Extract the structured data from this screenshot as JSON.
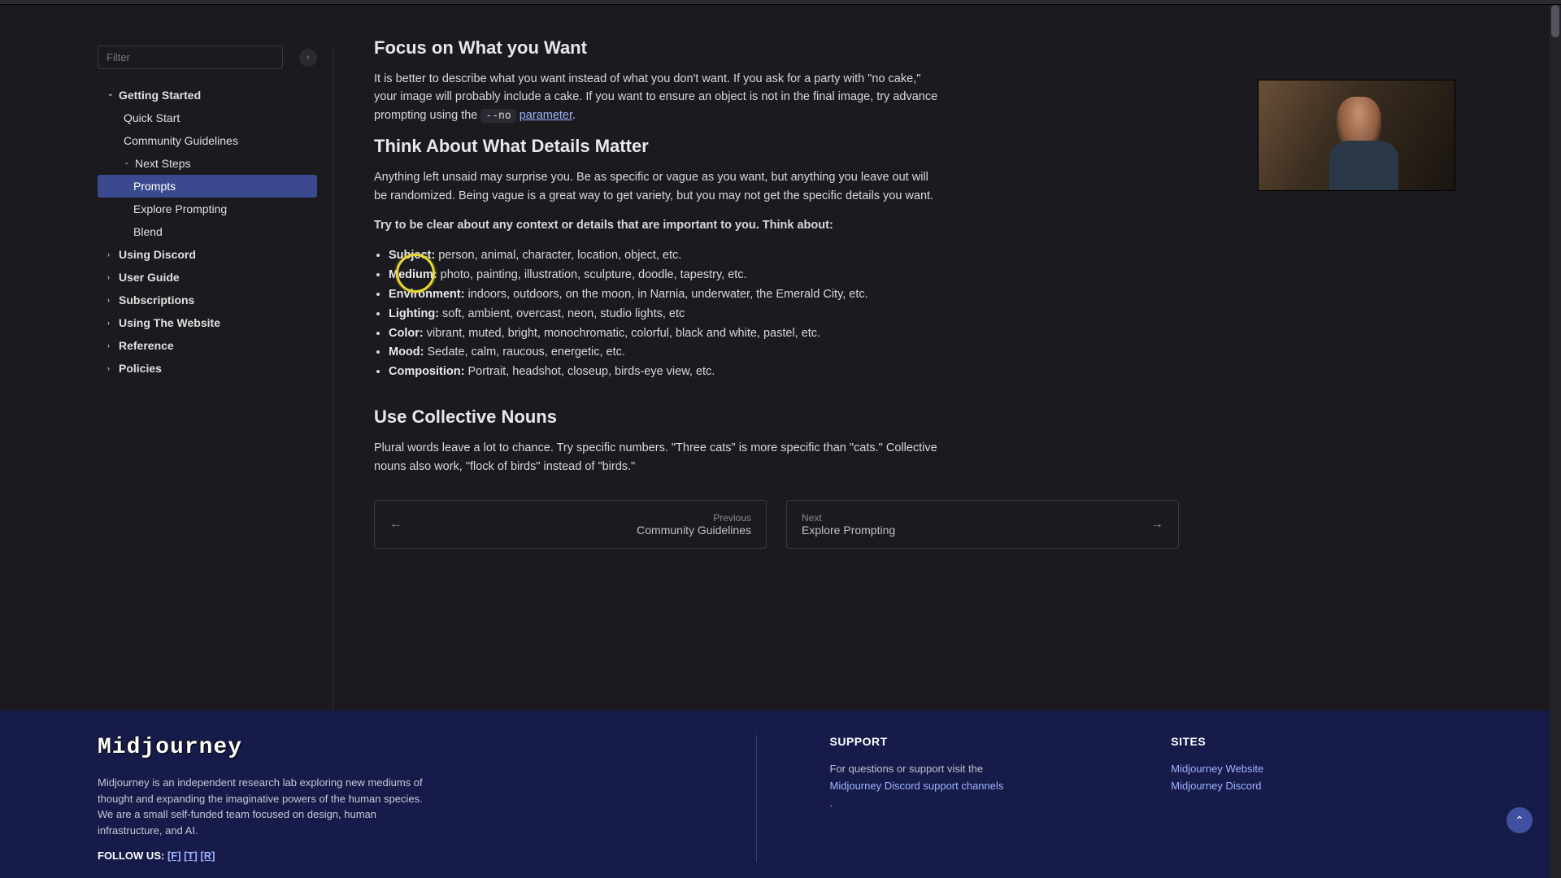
{
  "sidebar": {
    "filter_placeholder": "Filter",
    "items": [
      {
        "label": "Getting Started",
        "level": 1,
        "expanded": true
      },
      {
        "label": "Quick Start",
        "level": 2
      },
      {
        "label": "Community Guidelines",
        "level": 2
      },
      {
        "label": "Next Steps",
        "level": 2,
        "expanded": true,
        "hasChildren": true
      },
      {
        "label": "Prompts",
        "level": 3,
        "active": true
      },
      {
        "label": "Explore Prompting",
        "level": 3
      },
      {
        "label": "Blend",
        "level": 3
      },
      {
        "label": "Using Discord",
        "level": 1,
        "collapsed": true
      },
      {
        "label": "User Guide",
        "level": 1,
        "collapsed": true
      },
      {
        "label": "Subscriptions",
        "level": 1,
        "collapsed": true
      },
      {
        "label": "Using The Website",
        "level": 1,
        "collapsed": true
      },
      {
        "label": "Reference",
        "level": 1,
        "collapsed": true
      },
      {
        "label": "Policies",
        "level": 1,
        "collapsed": true
      }
    ]
  },
  "content": {
    "section1": {
      "heading": "Focus on What you Want",
      "body_pre": "It is better to describe what you want instead of what you don't want. If you ask for a party with \"no cake,\" your image will probably include a cake. If you want to ensure an object is not in the final image, try advance prompting using the ",
      "code": "--no",
      "link_text": "parameter",
      "body_post": "."
    },
    "section2": {
      "heading": "Think About What Details Matter",
      "p1": "Anything left unsaid may surprise you. Be as specific or vague as you want, but anything you leave out will be randomized. Being vague is a great way to get variety, but you may not get the specific details you want.",
      "p2": "Try to be clear about any context or details that are important to you. Think about:",
      "bullets": [
        {
          "label": "Subject:",
          "text": " person, animal, character, location, object, etc."
        },
        {
          "label": "Medium:",
          "text": " photo, painting, illustration, sculpture, doodle, tapestry, etc."
        },
        {
          "label": "Environment:",
          "text": " indoors, outdoors, on the moon, in Narnia, underwater, the Emerald City, etc."
        },
        {
          "label": "Lighting:",
          "text": " soft, ambient, overcast, neon, studio lights, etc"
        },
        {
          "label": "Color:",
          "text": " vibrant, muted, bright, monochromatic, colorful, black and white, pastel, etc."
        },
        {
          "label": "Mood:",
          "text": " Sedate, calm, raucous, energetic, etc."
        },
        {
          "label": "Composition:",
          "text": " Portrait, headshot, closeup, birds-eye view, etc."
        }
      ]
    },
    "section3": {
      "heading": "Use Collective Nouns",
      "body": "Plural words leave a lot to chance. Try specific numbers. \"Three cats\" is more specific than \"cats.\" Collective nouns also work, \"flock of birds\" instead of \"birds.\""
    }
  },
  "pagenav": {
    "prev_meta": "Previous",
    "prev_title": "Community Guidelines",
    "next_meta": "Next",
    "next_title": "Explore Prompting"
  },
  "footer": {
    "logo": "Midjourney",
    "desc": "Midjourney is an independent research lab exploring new mediums of thought and expanding the imaginative powers of the human species. We are a small self-funded team focused on design, human infrastructure, and AI.",
    "follow_label": "FOLLOW US: ",
    "social1": "[F]",
    "social2": "[T]",
    "social3": "[R]",
    "support_heading": "SUPPORT",
    "support_text": "For questions or support visit the ",
    "support_link": "Midjourney Discord support channels",
    "support_post": ".",
    "sites_heading": "SITES",
    "site1": "Midjourney Website",
    "site2": "Midjourney Discord"
  }
}
